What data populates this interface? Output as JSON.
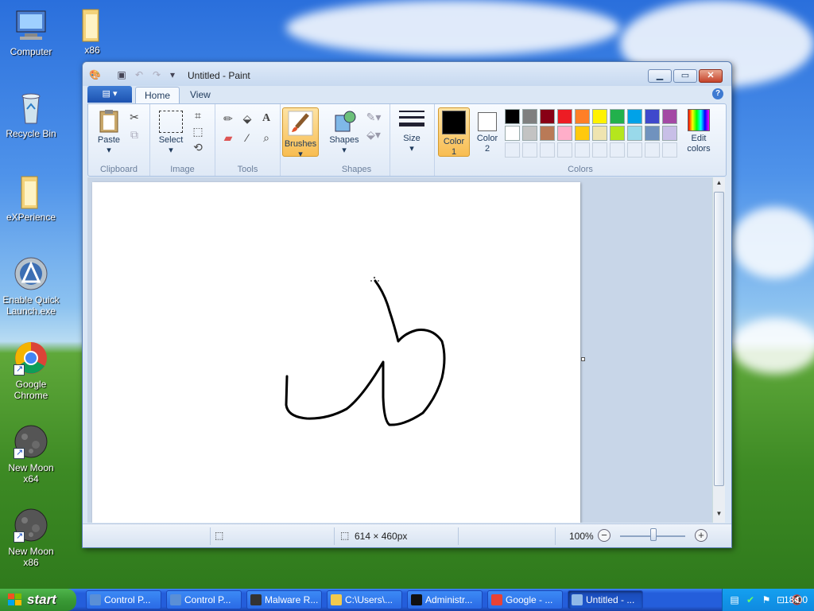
{
  "desktop": {
    "icons": [
      {
        "label": "Computer"
      },
      {
        "label": "x86"
      },
      {
        "label": "Recycle Bin"
      },
      {
        "label": "eXPerience"
      },
      {
        "label": "Enable Quick Launch.exe"
      },
      {
        "label": "Google Chrome"
      },
      {
        "label": "New Moon x64"
      },
      {
        "label": "New Moon x86"
      }
    ]
  },
  "window": {
    "title": "Untitled - Paint",
    "tabs": [
      {
        "label": "Home"
      },
      {
        "label": "View"
      }
    ],
    "ribbon": {
      "clipboard": {
        "label": "Clipboard",
        "paste": "Paste"
      },
      "image": {
        "label": "Image",
        "select": "Select"
      },
      "tools": {
        "label": "Tools"
      },
      "brushes": {
        "label": "Brushes"
      },
      "shapes": {
        "label": "Shapes",
        "shapes_btn": "Shapes"
      },
      "size": {
        "label": "Size"
      },
      "colors": {
        "label": "Colors",
        "color1": "Color\n1",
        "color1_a": "Color",
        "color1_b": "1",
        "color2_a": "Color",
        "color2_b": "2",
        "edit_a": "Edit",
        "edit_b": "colors",
        "color1_value": "#000000",
        "color2_value": "#ffffff",
        "palette_row1": [
          "#000000",
          "#7f7f7f",
          "#880015",
          "#ed1c24",
          "#ff7f27",
          "#fff200",
          "#22b14c",
          "#00a2e8",
          "#3f48cc",
          "#a349a4"
        ],
        "palette_row2": [
          "#ffffff",
          "#c3c3c3",
          "#b97a57",
          "#ffaec9",
          "#ffc90e",
          "#efe4b0",
          "#b5e61d",
          "#99d9ea",
          "#7092be",
          "#c8bfe7"
        ]
      }
    },
    "status": {
      "dimensions": "614 × 460px",
      "zoom": "100%"
    }
  },
  "taskbar": {
    "start": "start",
    "buttons": [
      {
        "label": "Control P...",
        "color": "#5a8fd6"
      },
      {
        "label": "Control P...",
        "color": "#5a8fd6"
      },
      {
        "label": "Malware R...",
        "color": "#333333"
      },
      {
        "label": "C:\\Users\\...",
        "color": "#f2c94c"
      },
      {
        "label": "Administr...",
        "color": "#111111"
      },
      {
        "label": "Google - ...",
        "color": "#e94235"
      },
      {
        "label": "Untitled - ...",
        "color": "#8fb8e8"
      }
    ],
    "clock": "18:00"
  }
}
